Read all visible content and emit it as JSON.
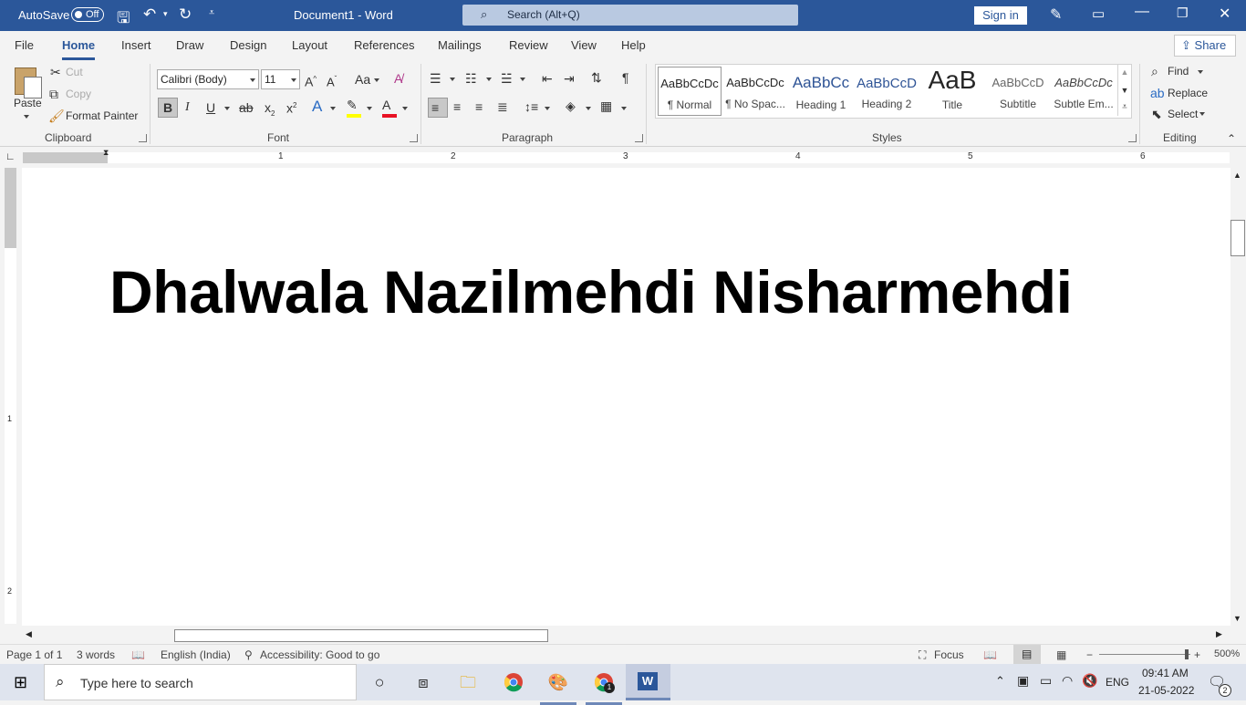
{
  "titlebar": {
    "autosave_label": "AutoSave",
    "autosave_state": "Off",
    "document_title": "Document1 - Word",
    "search_placeholder": "Search (Alt+Q)",
    "signin_label": "Sign in"
  },
  "menu": {
    "items": [
      "File",
      "Home",
      "Insert",
      "Draw",
      "Design",
      "Layout",
      "References",
      "Mailings",
      "Review",
      "View",
      "Help"
    ],
    "active": "Home",
    "share_label": "Share"
  },
  "ribbon": {
    "clipboard": {
      "paste": "Paste",
      "cut": "Cut",
      "copy": "Copy",
      "format_painter": "Format Painter",
      "label": "Clipboard"
    },
    "font": {
      "font_name": "Calibri (Body)",
      "font_size": "11",
      "label": "Font"
    },
    "paragraph": {
      "label": "Paragraph"
    },
    "styles": {
      "label": "Styles",
      "items": [
        {
          "preview": "AaBbCcDc",
          "name": "¶ Normal"
        },
        {
          "preview": "AaBbCcDc",
          "name": "¶ No Spac..."
        },
        {
          "preview": "AaBbCc",
          "name": "Heading 1"
        },
        {
          "preview": "AaBbCcD",
          "name": "Heading 2"
        },
        {
          "preview": "AaB",
          "name": "Title"
        },
        {
          "preview": "AaBbCcD",
          "name": "Subtitle"
        },
        {
          "preview": "AaBbCcDc",
          "name": "Subtle Em..."
        }
      ]
    },
    "editing": {
      "find": "Find",
      "replace": "Replace",
      "select": "Select",
      "label": "Editing"
    }
  },
  "ruler": {
    "numbers": [
      "1",
      "2",
      "3",
      "4",
      "5",
      "6"
    ],
    "vnumbers": [
      "1",
      "2"
    ]
  },
  "document": {
    "text": "Dhalwala Nazilmehdi Nisharmehdi"
  },
  "statusbar": {
    "page": "Page 1 of 1",
    "words": "3 words",
    "language": "English (India)",
    "accessibility": "Accessibility: Good to go",
    "focus": "Focus",
    "zoom": "500%"
  },
  "taskbar": {
    "search_placeholder": "Type here to search",
    "language": "ENG",
    "time": "09:41 AM",
    "date": "21-05-2022",
    "notification_count": "2",
    "chrome_badge": "1"
  },
  "colors": {
    "brand": "#2b579a",
    "highlight": "#ffff00",
    "font_color": "#e81123"
  }
}
